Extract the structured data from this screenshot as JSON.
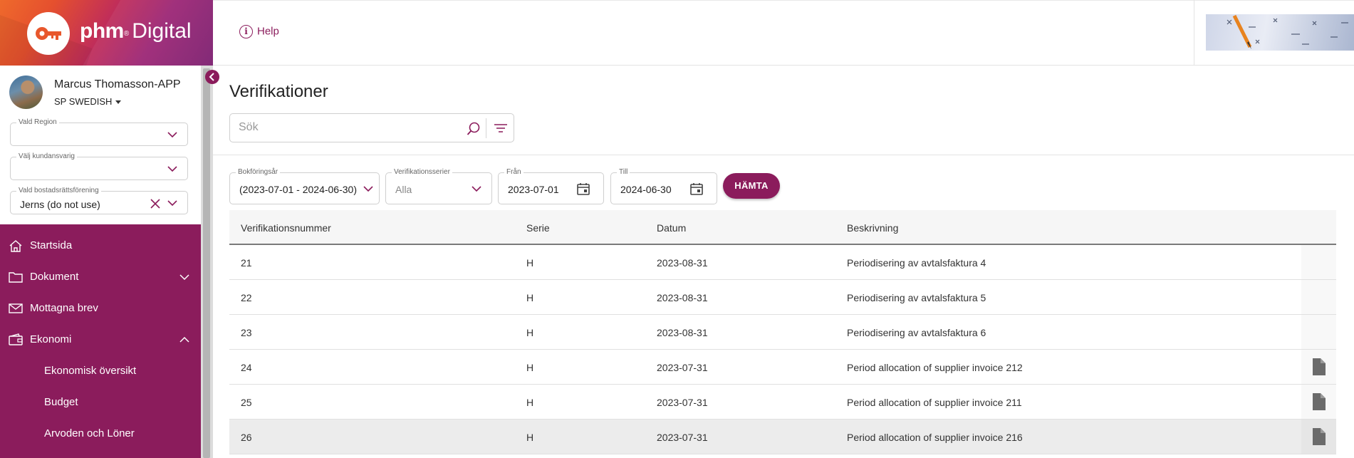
{
  "brand": {
    "name_bold": "phm",
    "name_sup": "®",
    "name_light": "Digital"
  },
  "header": {
    "help_label": "Help",
    "help_icon": "info-circle-icon"
  },
  "user": {
    "name": "Marcus Thomasson-APP",
    "org": "SP SWEDISH"
  },
  "filters_sidebar": {
    "region": {
      "label": "Vald Region",
      "value": ""
    },
    "customer": {
      "label": "Välj kundansvarig",
      "value": ""
    },
    "association": {
      "label": "Vald bostadsrättsförening",
      "value": "Jerns (do not use)"
    }
  },
  "nav": {
    "items": [
      {
        "label": "Startsida",
        "icon": "home-icon"
      },
      {
        "label": "Dokument",
        "icon": "folder-icon",
        "expanded": false
      },
      {
        "label": "Mottagna brev",
        "icon": "mail-icon"
      },
      {
        "label": "Ekonomi",
        "icon": "wallet-icon",
        "expanded": true
      }
    ],
    "sub_items": [
      {
        "label": "Ekonomisk översikt"
      },
      {
        "label": "Budget"
      },
      {
        "label": "Arvoden och Löner"
      }
    ]
  },
  "page": {
    "title": "Verifikationer"
  },
  "search": {
    "placeholder": "Sök"
  },
  "filters": {
    "fiscal_year": {
      "label": "Bokföringsår",
      "value": "(2023-07-01 - 2024-06-30)"
    },
    "series": {
      "label": "Verifikationsserier",
      "value": "Alla"
    },
    "from": {
      "label": "Från",
      "value": "2023-07-01"
    },
    "to": {
      "label": "Till",
      "value": "2024-06-30"
    },
    "fetch_label": "HÄMTA"
  },
  "table": {
    "columns": [
      "Verifikationsnummer",
      "Serie",
      "Datum",
      "Beskrivning"
    ],
    "rows": [
      {
        "number": "21",
        "series": "H",
        "date": "2023-08-31",
        "description": "Periodisering av avtalsfaktura 4",
        "has_document": false
      },
      {
        "number": "22",
        "series": "H",
        "date": "2023-08-31",
        "description": "Periodisering av avtalsfaktura 5",
        "has_document": false
      },
      {
        "number": "23",
        "series": "H",
        "date": "2023-08-31",
        "description": "Periodisering av avtalsfaktura 6",
        "has_document": false
      },
      {
        "number": "24",
        "series": "H",
        "date": "2023-07-31",
        "description": "Period allocation of supplier invoice 212",
        "has_document": true
      },
      {
        "number": "25",
        "series": "H",
        "date": "2023-07-31",
        "description": "Period allocation of supplier invoice 211",
        "has_document": true
      },
      {
        "number": "26",
        "series": "H",
        "date": "2023-07-31",
        "description": "Period allocation of supplier invoice 216",
        "has_document": true
      }
    ]
  },
  "colors": {
    "brand_purple": "#8b1c5c",
    "brand_orange": "#ef6a2c"
  }
}
